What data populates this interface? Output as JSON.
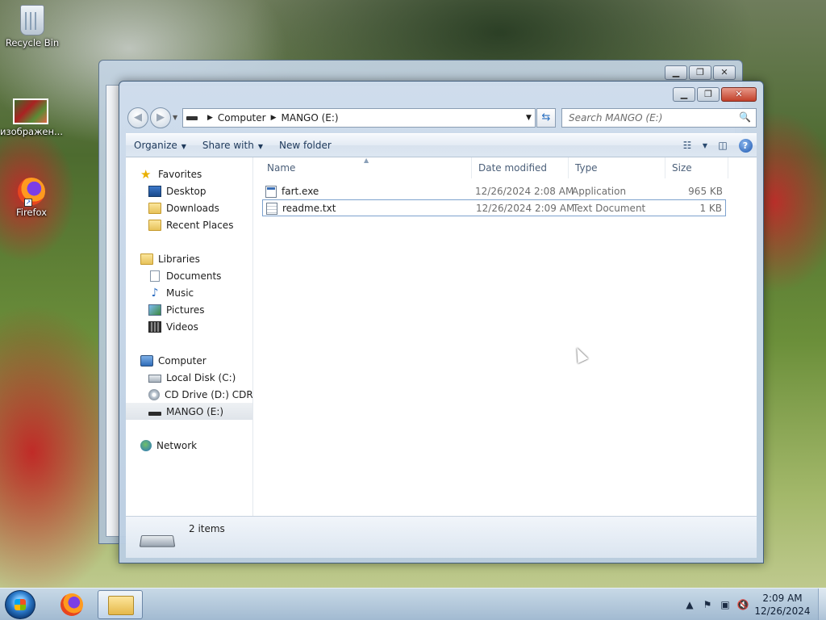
{
  "desktop": {
    "icons": [
      {
        "label": "Recycle Bin",
        "icon": "recycle-bin-icon"
      },
      {
        "label": "изображен...",
        "icon": "image-file-icon"
      },
      {
        "label": "Firefox",
        "icon": "firefox-icon"
      }
    ]
  },
  "window": {
    "address": {
      "crumbs": [
        "Computer",
        "MANGO (E:)"
      ]
    },
    "search": {
      "placeholder": "Search MANGO (E:)"
    },
    "toolbar": {
      "organize": "Organize",
      "share_with": "Share with",
      "new_folder": "New folder"
    },
    "nav": {
      "favorites": {
        "label": "Favorites",
        "items": [
          "Desktop",
          "Downloads",
          "Recent Places"
        ]
      },
      "libraries": {
        "label": "Libraries",
        "items": [
          "Documents",
          "Music",
          "Pictures",
          "Videos"
        ]
      },
      "computer": {
        "label": "Computer",
        "items": [
          "Local Disk (C:)",
          "CD Drive (D:) CDROM",
          "MANGO (E:)"
        ]
      },
      "network": {
        "label": "Network"
      },
      "selected": "MANGO (E:)"
    },
    "columns": [
      "Name",
      "Date modified",
      "Type",
      "Size"
    ],
    "files": [
      {
        "name": "fart.exe",
        "date": "12/26/2024 2:08 AM",
        "type": "Application",
        "size": "965 KB",
        "icon": "exe-file-icon"
      },
      {
        "name": "readme.txt",
        "date": "12/26/2024 2:09 AM",
        "type": "Text Document",
        "size": "1 KB",
        "icon": "text-file-icon"
      }
    ],
    "details": {
      "count": "2 items"
    }
  },
  "taskbar": {
    "clock": {
      "time": "2:09 AM",
      "date": "12/26/2024"
    }
  }
}
